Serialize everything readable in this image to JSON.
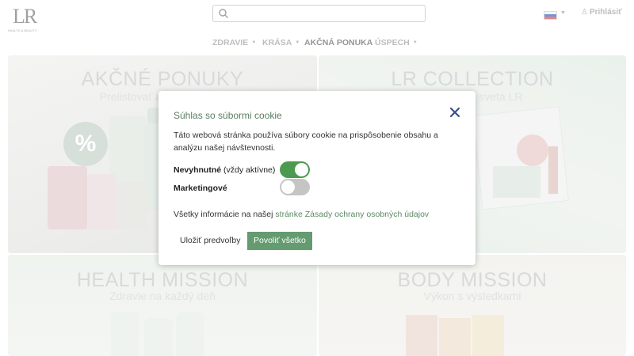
{
  "header": {
    "logo_text": "LR",
    "logo_tagline": "HEALTH & BEAUTY",
    "search_placeholder": "",
    "login_label": "Prihlásiť",
    "language_flag": "slovakia-flag-icon"
  },
  "nav": {
    "items": [
      {
        "label": "ZDRAVIE"
      },
      {
        "label": "KRÁSA"
      },
      {
        "label": "AKČNÁ PONUKA"
      },
      {
        "label": "ÚSPECH"
      }
    ]
  },
  "tiles": [
    {
      "title": "AKČNÉ PONUKY",
      "subtitle": "Prelistovať a"
    },
    {
      "title": "LR COLLECTION",
      "subtitle": "o sveta LR"
    },
    {
      "title": "HEALTH MISSION",
      "subtitle": "Zdravie na každý deň"
    },
    {
      "title": "BODY MISSION",
      "subtitle": "Výkon s výsledkami"
    }
  ],
  "cookie": {
    "title": "Súhlas so súbormi cookie",
    "description": "Táto webová stránka používa súbory cookie na prispôsobenie obsahu a analýzu našej návštevnosti.",
    "necessary_label": "Nevyhnutné",
    "necessary_note": "(vždy aktívne)",
    "necessary_on": true,
    "marketing_label": "Marketingové",
    "marketing_on": false,
    "info_text": "Všetky informácie na našej",
    "info_link": "stránke Zásady ochrany osobných údajov",
    "save_button": "Uložiť predvoľby",
    "allow_button": "Povoliť všetko"
  },
  "colors": {
    "accent_green": "#659b70",
    "toggle_on": "#4c9a4f",
    "toggle_off": "#c5c5c5",
    "title_green": "#5a7d5f",
    "close_blue": "#3a4f8f"
  }
}
